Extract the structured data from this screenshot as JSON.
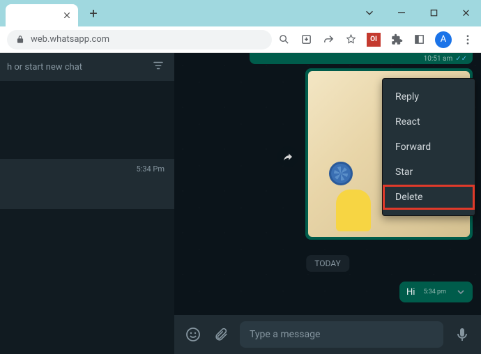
{
  "browser": {
    "url": "web.whatsapp.com",
    "avatar_letter": "A",
    "extension_badge": "OI"
  },
  "sidebar": {
    "search_placeholder": "h or start new chat",
    "chat_time": "5:34 Pm"
  },
  "chat": {
    "prev_bubble_time": "10:51 am",
    "date_separator": "TODAY",
    "hi_text": "Hi",
    "hi_time": "5:34 pm"
  },
  "context_menu": {
    "items": [
      "Reply",
      "React",
      "Forward",
      "Star",
      "Delete"
    ],
    "highlighted_index": 4
  },
  "composer": {
    "placeholder": "Type a message"
  }
}
